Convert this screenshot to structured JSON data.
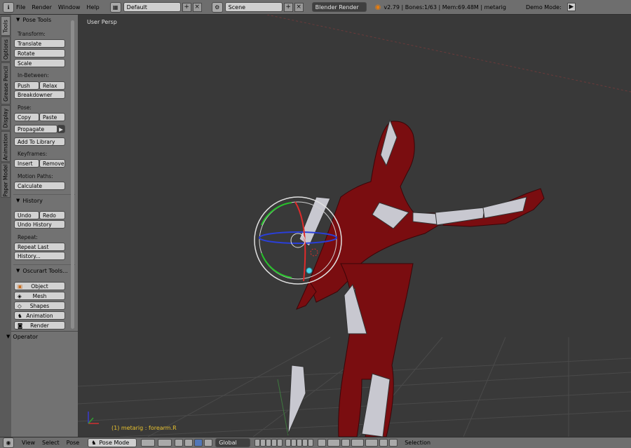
{
  "topbar": {
    "menus": [
      "File",
      "Render",
      "Window",
      "Help"
    ],
    "screen_layout": "Default",
    "scene": "Scene",
    "render_engine": "Blender Render",
    "stats": "v2.79 | Bones:1/63 | Mem:69.48M | metarig",
    "demo_mode": "Demo Mode:"
  },
  "left_tabs": [
    "Tools",
    "Options",
    "Grease Pencil",
    "Display",
    "Animation",
    "Paper Model"
  ],
  "panel": {
    "pose_tools": "Pose Tools",
    "transform_label": "Transform:",
    "translate": "Translate",
    "rotate": "Rotate",
    "scale": "Scale",
    "in_between_label": "In-Between:",
    "push": "Push",
    "relax": "Relax",
    "breakdowner": "Breakdowner",
    "pose_label": "Pose:",
    "copy": "Copy",
    "paste": "Paste",
    "propagate": "Propagate",
    "add_to_library": "Add To Library",
    "keyframes_label": "Keyframes:",
    "insert": "Insert",
    "remove": "Remove",
    "motion_paths_label": "Motion Paths:",
    "calculate": "Calculate",
    "history": "History",
    "undo": "Undo",
    "redo": "Redo",
    "undo_history": "Undo History",
    "repeat_label": "Repeat:",
    "repeat_last": "Repeat Last",
    "history_btn": "History...",
    "oscurart": "Oscurart Tools...",
    "object": "Object",
    "mesh": "Mesh",
    "shapes": "Shapes",
    "animation": "Animation",
    "render": "Render",
    "operator": "Operator"
  },
  "viewport": {
    "title": "User Persp",
    "status": "(1) metarig : forearm.R"
  },
  "bottombar": {
    "menus": [
      "View",
      "Select",
      "Pose"
    ],
    "mode": "Pose Mode",
    "orientation": "Global",
    "selection": "Selection"
  }
}
